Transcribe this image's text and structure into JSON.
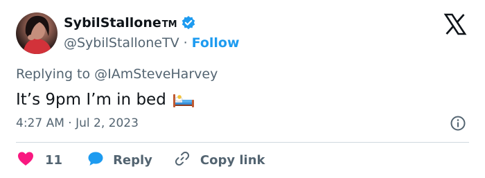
{
  "author": {
    "display_name": "SybilStallone",
    "name_suffix": "TM",
    "handle": "@SybilStalloneTV",
    "separator": "·",
    "follow_label": "Follow",
    "verified": true
  },
  "reply_context": "Replying to @IAmSteveHarvey",
  "tweet": {
    "text": "It’s 9pm I’m in bed",
    "emoji": "bed-emoji"
  },
  "timestamp": "4:27 AM · Jul 2, 2023",
  "actions": {
    "like_count": "11",
    "reply_label": "Reply",
    "copy_link_label": "Copy link"
  },
  "colors": {
    "accent": "#1d9bf0",
    "text": "#0f1419",
    "secondary": "#536471",
    "like": "#f91880",
    "divider": "#cfd9de"
  },
  "icons": {
    "brand": "x-logo-icon",
    "verified": "verified-badge-icon",
    "info": "info-icon",
    "like": "heart-icon",
    "reply": "speech-bubble-icon",
    "copy_link": "link-icon"
  }
}
